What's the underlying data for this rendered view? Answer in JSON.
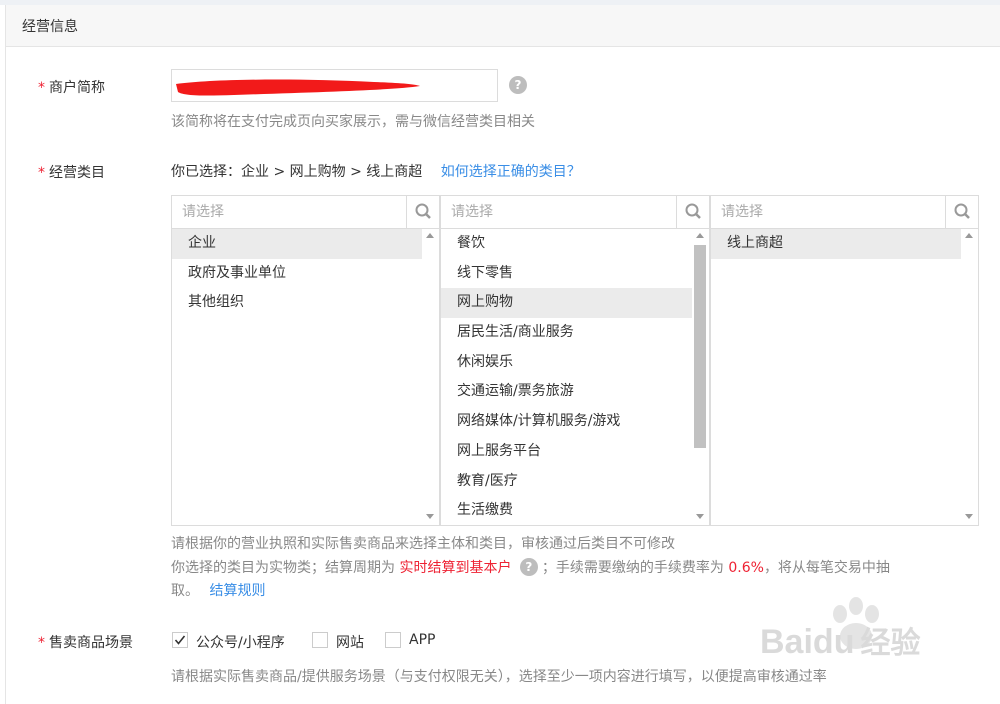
{
  "section": {
    "title": "经营信息"
  },
  "merchant": {
    "label": "商户简称",
    "required_mark": "*",
    "hint": "该简称将在支付完成页向买家展示，需与微信经营类目相关"
  },
  "category": {
    "label": "经营类目",
    "required_mark": "*",
    "selected_path": "你已选择：企业 > 网上购物 > 线上商超",
    "help_link": "如何选择正确的类目？",
    "columns": [
      {
        "placeholder": "请选择",
        "items": [
          "企业",
          "政府及事业单位",
          "其他组织"
        ],
        "selected": "企业"
      },
      {
        "placeholder": "请选择",
        "items": [
          "餐饮",
          "线下零售",
          "网上购物",
          "居民生活/商业服务",
          "休闲娱乐",
          "交通运输/票务旅游",
          "网络媒体/计算机服务/游戏",
          "网上服务平台",
          "教育/医疗",
          "生活缴费"
        ],
        "selected": "网上购物"
      },
      {
        "placeholder": "请选择",
        "items": [
          "线上商超"
        ],
        "selected": "线上商超"
      }
    ],
    "note1": "请根据你的营业执照和实际售卖商品来选择主体和类目，审核通过后类目不可修改",
    "note2_a": "你选择的类目为实物类；结算周期为 ",
    "note2_highlight": "实时结算到基本户",
    "note2_b": "；手续需要缴纳的手续费率为 ",
    "note2_rate": "0.6%",
    "note2_c": "，将从每笔交易中抽",
    "note3": "取。",
    "rules_link": "结算规则"
  },
  "scenes": {
    "label": "售卖商品场景",
    "required_mark": "*",
    "options": [
      {
        "label": "公众号/小程序",
        "checked": true
      },
      {
        "label": "网站",
        "checked": false
      },
      {
        "label": "APP",
        "checked": false
      }
    ],
    "hint": "请根据实际售卖商品/提供服务场景（与支付权限无关），选择至少一项内容进行填写，以便提高审核通过率"
  },
  "watermark": {
    "brand": "Bai",
    "brand_end": "du",
    "subtitle": "经验"
  },
  "colors": {
    "required": "#e23",
    "link": "#3a8ee6",
    "rate": "#e23"
  }
}
